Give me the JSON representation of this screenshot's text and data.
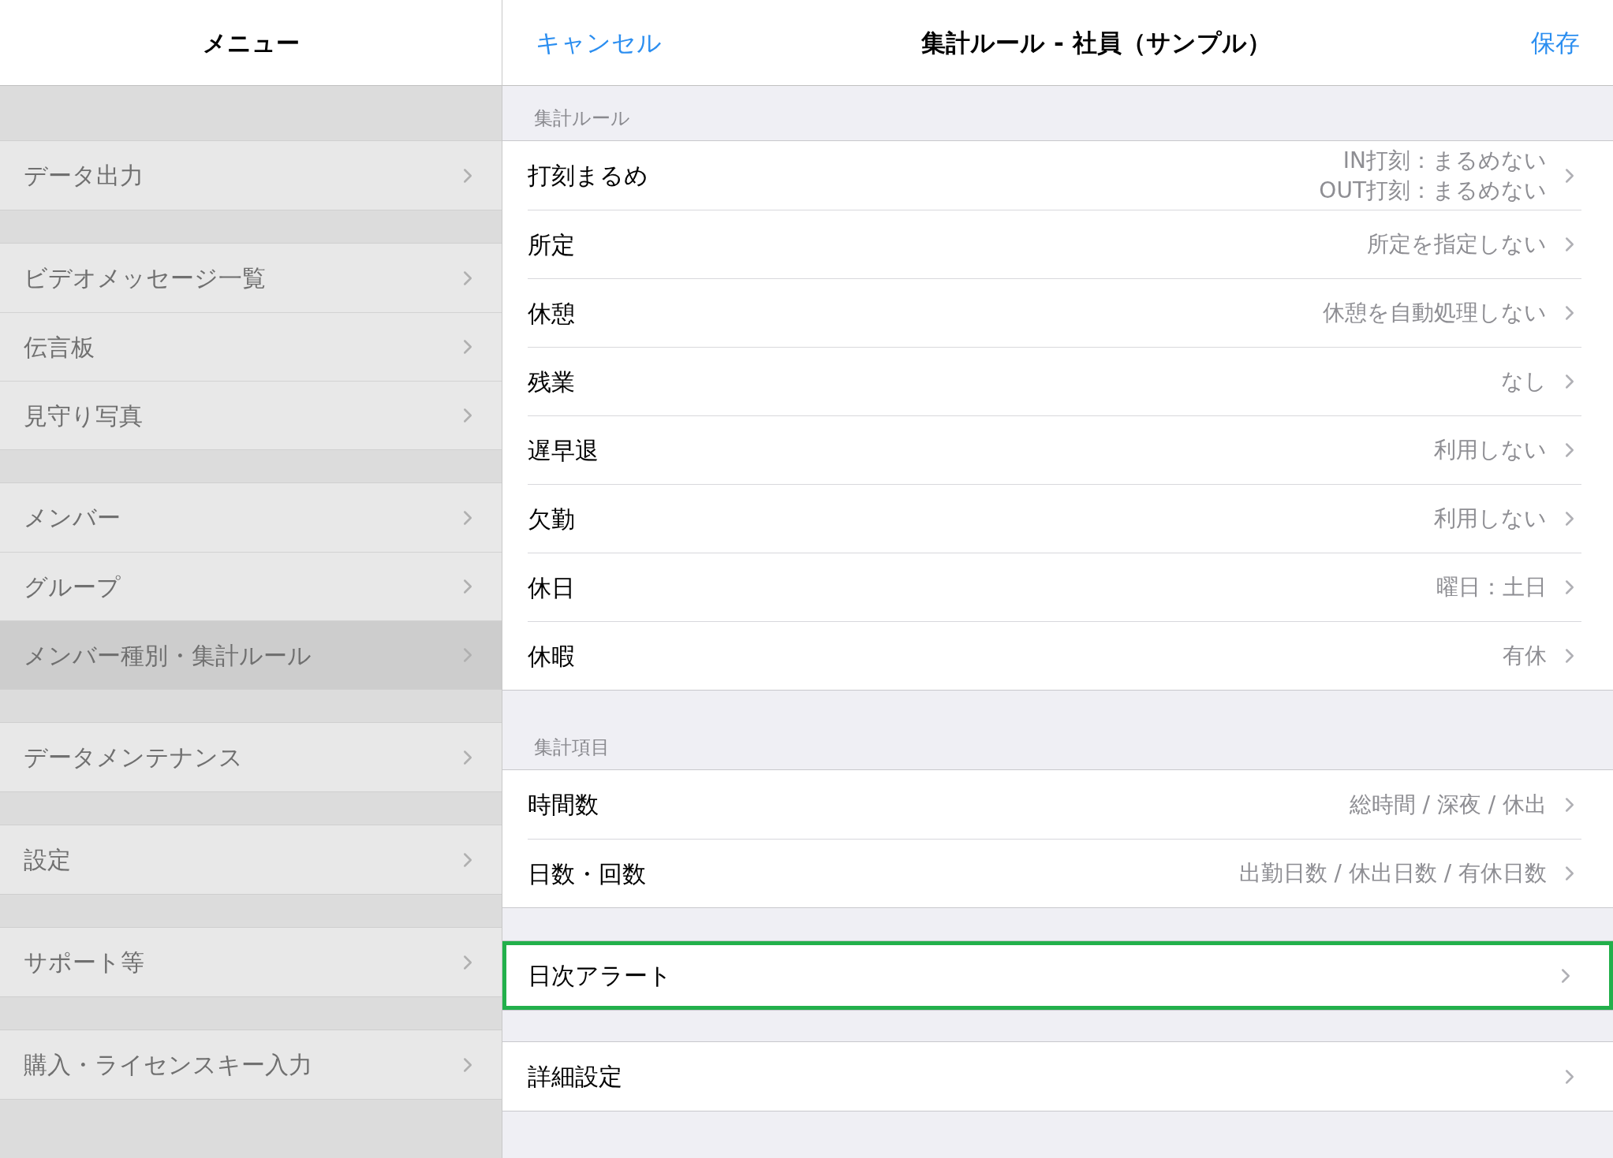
{
  "menu": {
    "title": "メニュー",
    "groups": [
      [
        {
          "label": "データ出力",
          "selected": false
        }
      ],
      [
        {
          "label": "ビデオメッセージ一覧",
          "selected": false
        },
        {
          "label": "伝言板",
          "selected": false
        },
        {
          "label": "見守り写真",
          "selected": false
        }
      ],
      [
        {
          "label": "メンバー",
          "selected": false
        },
        {
          "label": "グループ",
          "selected": false
        },
        {
          "label": "メンバー種別・集計ルール",
          "selected": true
        }
      ],
      [
        {
          "label": "データメンテナンス",
          "selected": false
        }
      ],
      [
        {
          "label": "設定",
          "selected": false
        }
      ],
      [
        {
          "label": "サポート等",
          "selected": false
        }
      ],
      [
        {
          "label": "購入・ライセンスキー入力",
          "selected": false
        }
      ]
    ]
  },
  "detail": {
    "cancel": "キャンセル",
    "title": "集計ルール - 社員（サンプル）",
    "save": "保存",
    "sections": [
      {
        "header": "集計ルール",
        "rows": [
          {
            "label": "打刻まるめ",
            "value": [
              "IN打刻：まるめない",
              "OUT打刻：まるめない"
            ],
            "highlighted": false
          },
          {
            "label": "所定",
            "value": [
              "所定を指定しない"
            ],
            "highlighted": false
          },
          {
            "label": "休憩",
            "value": [
              "休憩を自動処理しない"
            ],
            "highlighted": false
          },
          {
            "label": "残業",
            "value": [
              "なし"
            ],
            "highlighted": false
          },
          {
            "label": "遅早退",
            "value": [
              "利用しない"
            ],
            "highlighted": false
          },
          {
            "label": "欠勤",
            "value": [
              "利用しない"
            ],
            "highlighted": false
          },
          {
            "label": "休日",
            "value": [
              "曜日：土日"
            ],
            "highlighted": false
          },
          {
            "label": "休暇",
            "value": [
              "有休"
            ],
            "highlighted": false
          }
        ]
      },
      {
        "header": "集計項目",
        "rows": [
          {
            "label": "時間数",
            "value": [
              "総時間 / 深夜 / 休出"
            ],
            "highlighted": false
          },
          {
            "label": "日数・回数",
            "value": [
              "出勤日数 / 休出日数 / 有休日数"
            ],
            "highlighted": false
          }
        ]
      },
      {
        "rows": [
          {
            "label": "日次アラート",
            "highlighted": true
          }
        ]
      },
      {
        "rows": [
          {
            "label": "詳細設定",
            "highlighted": false
          }
        ]
      }
    ]
  }
}
